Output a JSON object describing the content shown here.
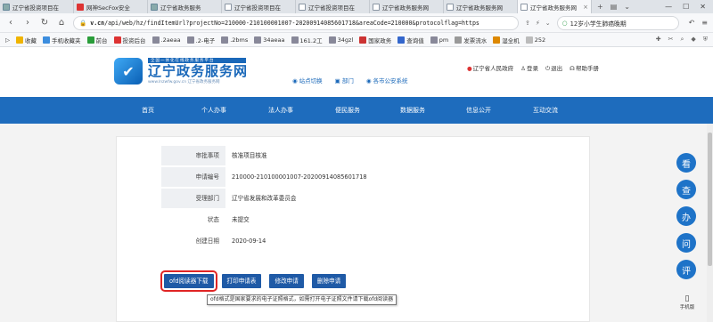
{
  "browser": {
    "tabs": [
      {
        "label": "辽宁省投资项目在",
        "icon": "img"
      },
      {
        "label": "网神SecFox安全",
        "icon": "red"
      },
      {
        "label": "辽宁省政务服务",
        "icon": "img"
      },
      {
        "label": "辽宁省投资项目在",
        "icon": "doc"
      },
      {
        "label": "辽宁省投资项目在",
        "icon": "doc"
      },
      {
        "label": "辽宁省政务服务网",
        "icon": "doc"
      },
      {
        "label": "辽宁省政务服务网",
        "icon": "doc"
      },
      {
        "label": "辽宁省政务服务网",
        "icon": "doc",
        "active": true
      }
    ],
    "new_tab": "+",
    "url_domain": "v.cn",
    "url_rest": "/api/web/hz/findItemUrl?projectNo=210000-210100001007-20200914085601718&areaCode=210000&protocolflag=https",
    "search_text": "12岁小学生肺癌晚期",
    "bookmarks": [
      {
        "label": "收藏",
        "color": "#f0b400"
      },
      {
        "label": "手机收藏夹",
        "color": "#3c8dde"
      },
      {
        "label": "前台",
        "color": "#2a9d3a"
      },
      {
        "label": "投资后台",
        "color": "#d33"
      },
      {
        "label": ".2aeaa",
        "color": "#889"
      },
      {
        "label": ".2-电子",
        "color": "#889"
      },
      {
        "label": ".2bms",
        "color": "#889"
      },
      {
        "label": "34aeaa",
        "color": "#889"
      },
      {
        "label": "161.2工",
        "color": "#889"
      },
      {
        "label": "34gzl",
        "color": "#889"
      },
      {
        "label": "国家政务",
        "color": "#c33"
      },
      {
        "label": "查询值",
        "color": "#36c"
      },
      {
        "label": "pm",
        "color": "#889"
      },
      {
        "label": "发票流水",
        "color": "#999"
      },
      {
        "label": "湿全机",
        "color": "#d80"
      },
      {
        "label": "252",
        "color": "#bbb"
      }
    ]
  },
  "site": {
    "logo_small": "全国一体化在线政务服务平台",
    "logo_title": "辽宁政务服务网",
    "logo_url": "www.lnzwfw.gov.cn 辽宁省政务服务网",
    "header_links": [
      "站点切换",
      "部门",
      "各市公安系统"
    ],
    "top_links": [
      "辽宁省人民政府",
      "登录",
      "退出",
      "帮助手册"
    ],
    "nav": [
      "首页",
      "个人办事",
      "法人办事",
      "便民服务",
      "数据服务",
      "信息公开",
      "互动交流"
    ]
  },
  "detail": {
    "rows": [
      {
        "label": "审批事项",
        "value": "核准项目核准"
      },
      {
        "label": "申请编号",
        "value": "210000-210100001007-20200914085601718"
      },
      {
        "label": "受理部门",
        "value": "辽宁省发展和改革委员会"
      },
      {
        "label": "状态",
        "value": "未提交"
      },
      {
        "label": "创建日期",
        "value": "2020-09-14"
      }
    ],
    "buttons": [
      "ofd阅读器下载",
      "打印申请表",
      "修改申请",
      "删除申请"
    ],
    "tooltip": "ofd格式是国家要求的电子证照格式，如需打开电子证照文件请下载ofd阅读器"
  },
  "float": {
    "items": [
      "看",
      "查",
      "办",
      "问",
      "评"
    ],
    "mobile": "手机版"
  },
  "colors": {
    "nav_blue": "#1e6cbd",
    "button_blue": "#1f5aa6",
    "highlight_red": "#e02525"
  }
}
